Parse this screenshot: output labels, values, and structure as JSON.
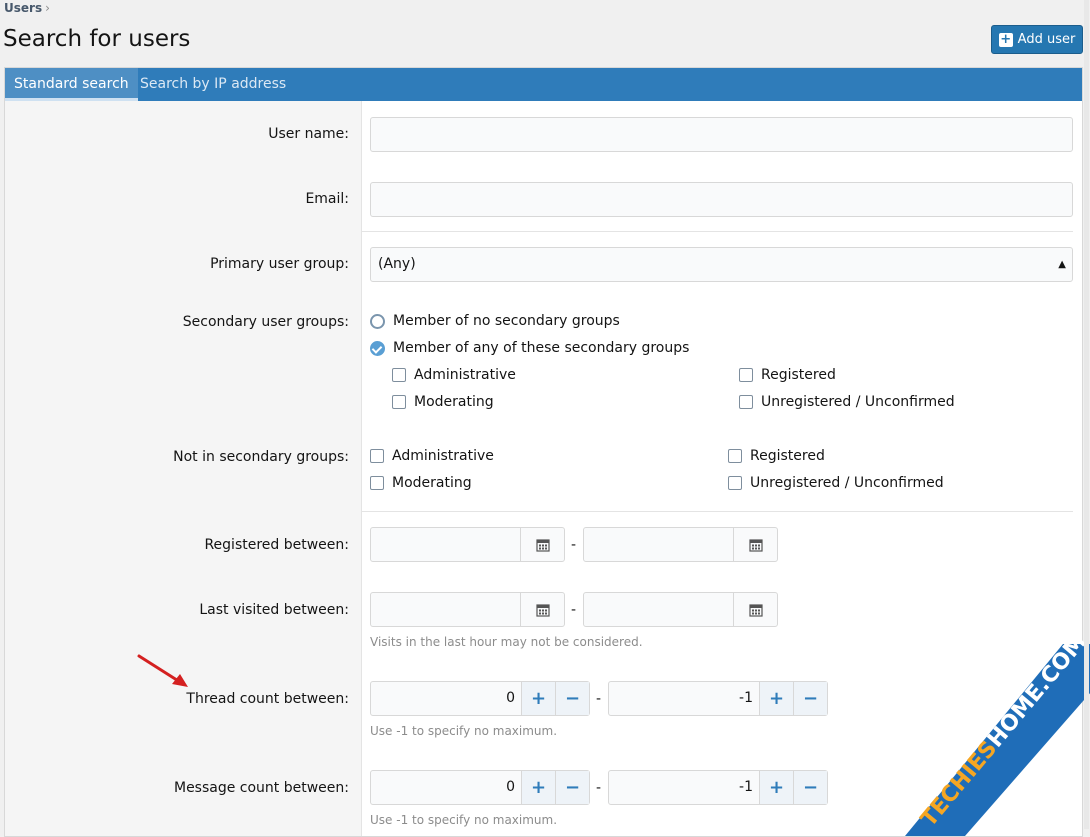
{
  "breadcrumb": {
    "item": "Users",
    "separator": "›"
  },
  "page_title": "Search for users",
  "add_user_label": "Add user",
  "tabs": [
    {
      "label": "Standard search",
      "active": true
    },
    {
      "label": "Search by IP address",
      "active": false
    }
  ],
  "fields": {
    "username_label": "User name:",
    "email_label": "Email:",
    "primary_group_label": "Primary user group:",
    "primary_group_value": "(Any)",
    "secondary_groups_label": "Secondary user groups:",
    "secondary_radio_none": "Member of no secondary groups",
    "secondary_radio_any": "Member of any of these secondary groups",
    "secondary_checkboxes": [
      "Administrative",
      "Registered",
      "Moderating",
      "Unregistered / Unconfirmed"
    ],
    "not_in_label": "Not in secondary groups:",
    "not_in_checkboxes": [
      "Administrative",
      "Registered",
      "Moderating",
      "Unregistered / Unconfirmed"
    ],
    "registered_label": "Registered between:",
    "last_visited_label": "Last visited between:",
    "last_visited_hint": "Visits in the last hour may not be considered.",
    "thread_count_label": "Thread count between:",
    "thread_min": "0",
    "thread_max": "-1",
    "thread_hint": "Use -1 to specify no maximum.",
    "message_count_label": "Message count between:",
    "message_min": "0",
    "message_max": "-1",
    "message_hint": "Use -1 to specify no maximum.",
    "range_separator": "-",
    "plus": "+",
    "minus": "−"
  },
  "watermark": "TECHIESHOME.COM",
  "colors": {
    "accent": "#2f7cba",
    "button": "#2577b1",
    "arrow": "#d42020",
    "watermark_bg": "#1f6db8",
    "watermark_text": "#f5a623"
  }
}
